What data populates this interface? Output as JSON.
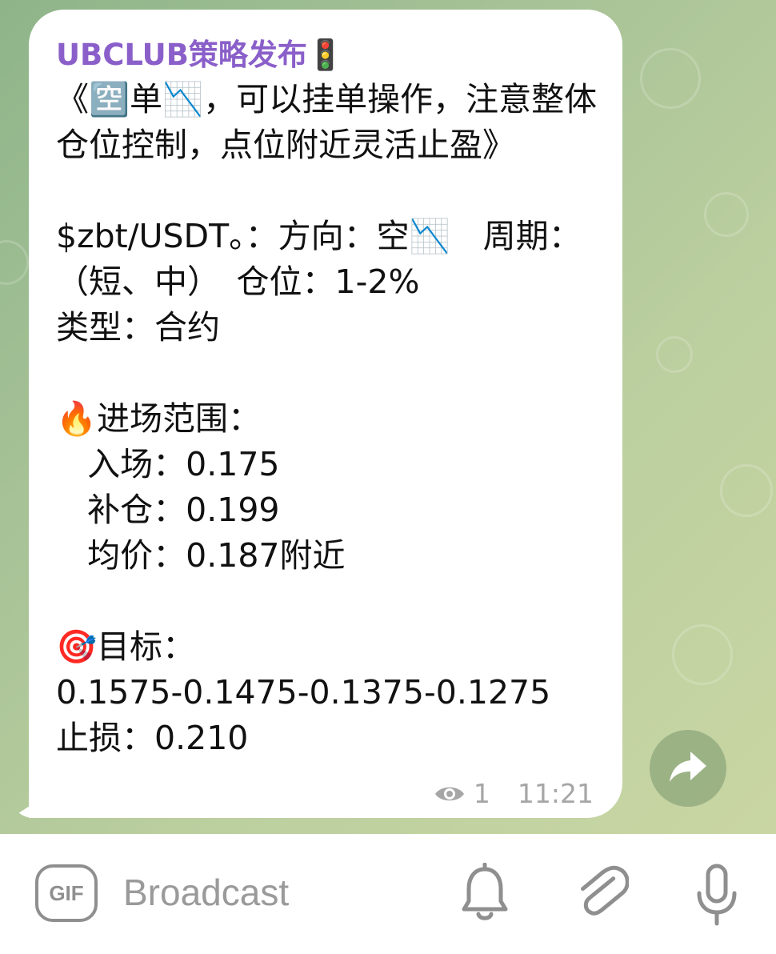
{
  "message": {
    "sender": "UBCLUB策略发布🚦",
    "text": "《🈳单📉，可以挂单操作，注意整体仓位控制，点位附近灵活止盈》\n\n$zbt/USDT。：方向：空📉　周期：（短、中）　仓位：1-2%\n类型：合约\n\n🔥进场范围：\n   入场：0.175\n   补仓：0.199\n   均价：0.187附近\n\n🎯目标：\n0.1575-0.1475-0.1375-0.1275\n止损：0.210",
    "views": "1",
    "time": "11:21"
  },
  "composer": {
    "gif_label": "GIF",
    "placeholder": "Broadcast"
  },
  "icons": {
    "views": "eye-icon",
    "share": "share-arrow-icon",
    "notify": "bell-icon",
    "attach": "paperclip-icon",
    "voice": "microphone-icon"
  },
  "colors": {
    "sender": "#8a5fc9",
    "chat_background": "#a8c397",
    "meta_text": "#a6a6a6",
    "bottom_icon": "#8f8f8f"
  }
}
